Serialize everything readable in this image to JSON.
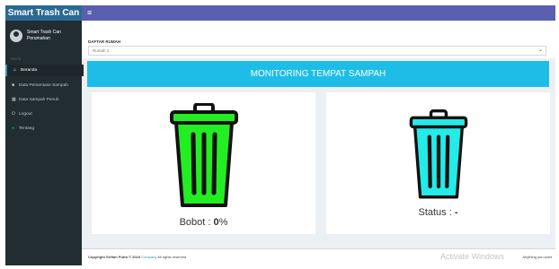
{
  "brand": {
    "title": "Smart Trash Can"
  },
  "header": {
    "toggle_icon": "hamburger-icon"
  },
  "sidebar": {
    "user_name": "Smart Trash Can Perumahan",
    "menu_header": "Menu",
    "items": [
      {
        "label": "Beranda",
        "icon": "home-icon"
      },
      {
        "label": "Data Persentase Sampah",
        "icon": "database-icon"
      },
      {
        "label": "Data Sampah Penuh",
        "icon": "trash-icon"
      },
      {
        "label": "Logout",
        "icon": "logout-icon"
      },
      {
        "label": "Tentang",
        "icon": "info-icon"
      }
    ]
  },
  "filter": {
    "label": "DAFTAR RUMAH",
    "value": "Rumah 1"
  },
  "banner": {
    "title": "MONITORING TEMPAT SAMPAH"
  },
  "panels": {
    "bobot": {
      "label": "Bobot : ",
      "value": "0",
      "unit": "%",
      "color": "#22ee22"
    },
    "status": {
      "label": "Status : ",
      "value": "-",
      "color": "#22ebe8"
    }
  },
  "footer": {
    "copyright": "Copyright Sriftan Putra © 2024",
    "company": "Company",
    "rights": "All rights reserved.",
    "version": "Anything you want"
  },
  "watermark": {
    "text": "Activate Windows"
  }
}
